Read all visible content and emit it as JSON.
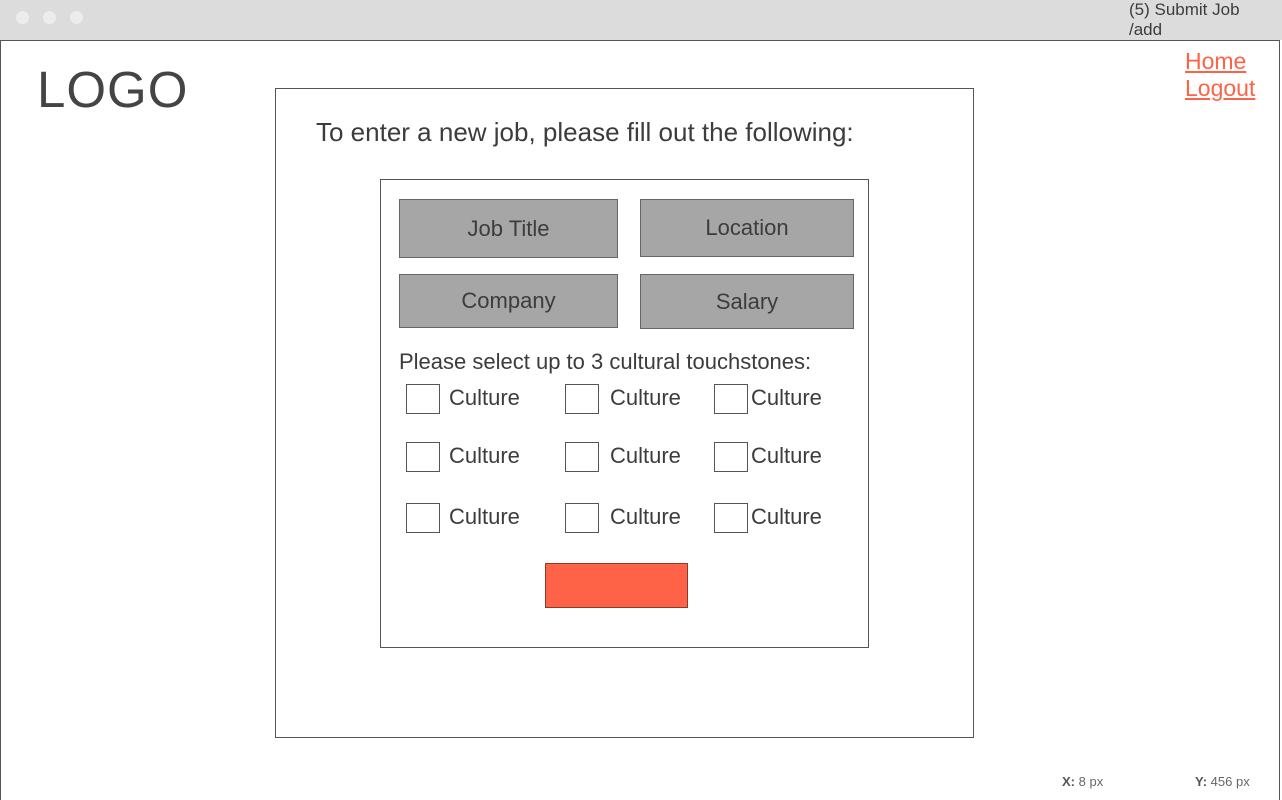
{
  "window": {
    "title_line1": "(5) Submit Job",
    "title_line2": "/add"
  },
  "header": {
    "logo": "LOGO",
    "nav": {
      "home": "Home",
      "logout": "Logout"
    }
  },
  "form": {
    "heading": "To enter a new job, please fill out the following:",
    "fields": {
      "job_title": "Job Title",
      "location": "Location",
      "company": "Company",
      "salary": "Salary"
    },
    "culture_prompt": "Please select up to 3 cultural touchstones:",
    "cultures": [
      "Culture",
      "Culture",
      "Culture",
      "Culture",
      "Culture",
      "Culture",
      "Culture",
      "Culture",
      "Culture"
    ],
    "submit_label": ""
  },
  "status": {
    "x_label": "X:",
    "x_value": "8 px",
    "y_label": "Y:",
    "y_value": "456 px"
  },
  "colors": {
    "accent": "#ff6347",
    "field_bg": "#a6a6a6",
    "titlebar": "#dcdcdc"
  }
}
